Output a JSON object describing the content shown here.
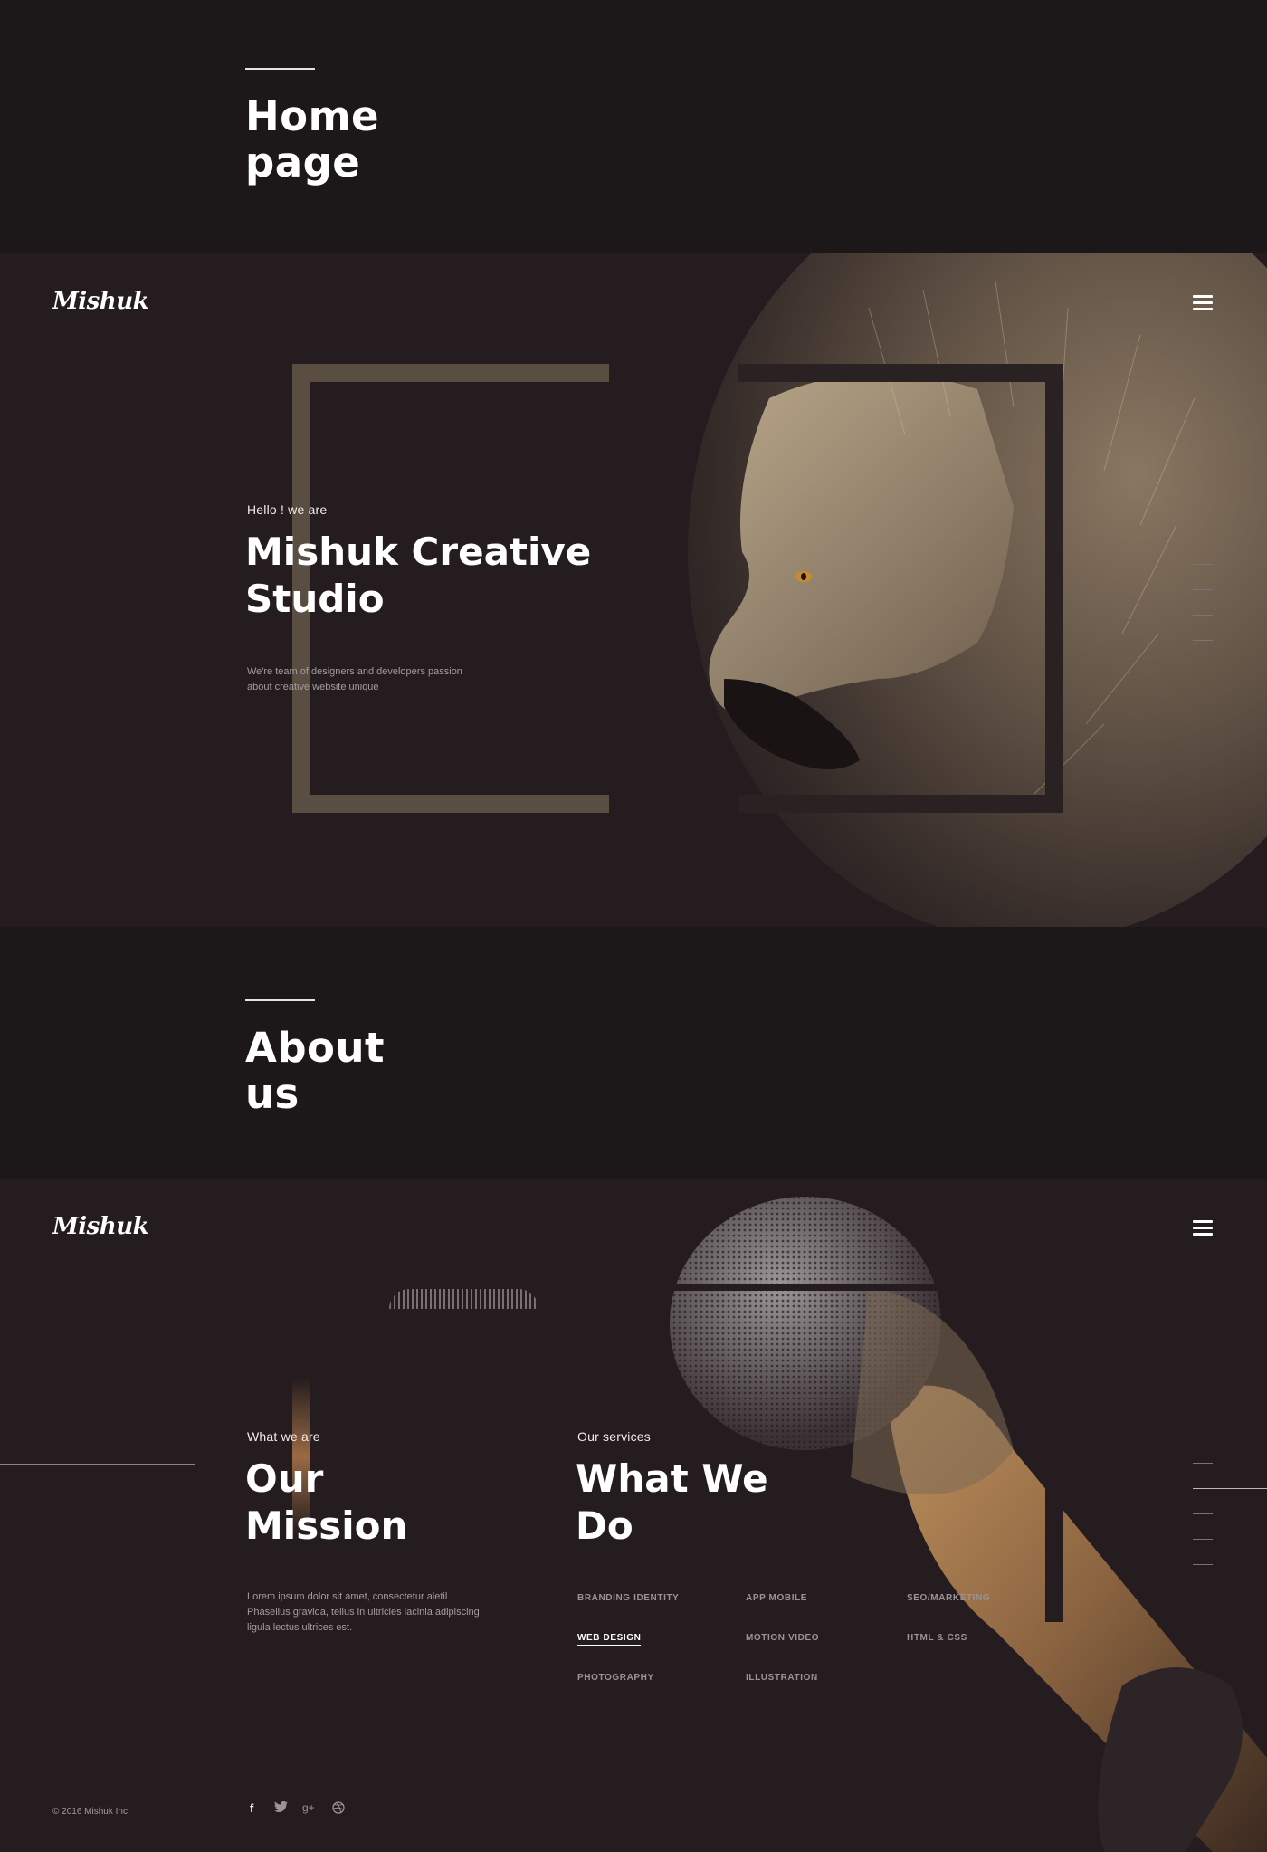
{
  "home_title": {
    "text": "Home\npage"
  },
  "hero": {
    "logo": "Mishuk",
    "eyebrow": "Hello ! we are",
    "title": "Mishuk Creative\nStudio",
    "description": "We're team of designers and developers passion\nabout creative website unique"
  },
  "about_title": {
    "text": "About\nus"
  },
  "about": {
    "logo": "Mishuk",
    "mission": {
      "eyebrow": "What we are",
      "title": "Our\nMission",
      "description": "Lorem ipsum dolor sit amet, consectetur aletil\nPhasellus gravida, tellus in ultricies lacinia adipiscing\nligula lectus ultrices est."
    },
    "services": {
      "eyebrow": "Our services",
      "title": "What We\nDo",
      "items": [
        "BRANDING IDENTITY",
        "APP MOBILE",
        "SEO/MARKETING",
        "WEB DESIGN",
        "MOTION VIDEO",
        "HTML & CSS",
        "PHOTOGRAPHY",
        "ILLUSTRATION"
      ],
      "active": "WEB DESIGN"
    },
    "footer": {
      "copyright": "© 2016 Mishuk Inc.",
      "social": [
        "f",
        "t",
        "g+",
        "dribbble"
      ]
    }
  },
  "colors": {
    "background": "#1c1718",
    "section_background": "#241c1e",
    "accent_lion": "#c4ad8e",
    "accent_mic": "#a07850"
  },
  "icons": [
    "menu-icon",
    "facebook-icon",
    "twitter-icon",
    "google-plus-icon",
    "dribbble-icon"
  ]
}
